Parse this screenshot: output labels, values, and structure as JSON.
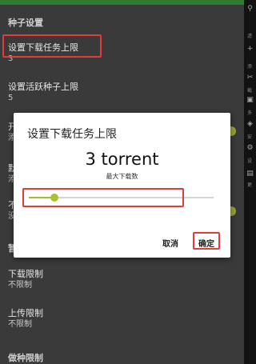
{
  "settings": {
    "section_title": "种子设置",
    "items": [
      {
        "title": "设置下载任务上限",
        "value": "3"
      },
      {
        "title": "设置活跃种子上限",
        "value": "5"
      },
      {
        "title": "开",
        "value": "添"
      },
      {
        "title": "默",
        "value": "添"
      },
      {
        "title": "不",
        "value": "没"
      },
      {
        "title": "下载限制",
        "value": "不限制"
      },
      {
        "title": "上传限制",
        "value": "不限制"
      }
    ],
    "partial_header": "暂",
    "bottom_section_title": "做种限制"
  },
  "dialog": {
    "title": "设置下载任务上限",
    "value_display": "3 torrent",
    "subtitle": "最大下载数",
    "slider_fraction": 0.14,
    "cancel_label": "取消",
    "ok_label": "确定"
  },
  "right_panel": {
    "labels": [
      "滤",
      "添",
      "截",
      "多",
      "安",
      "设",
      "更"
    ]
  },
  "colors": {
    "accent": "#9cbf2b",
    "highlight": "#e23b3b",
    "statusbar": "#2e7d32"
  }
}
